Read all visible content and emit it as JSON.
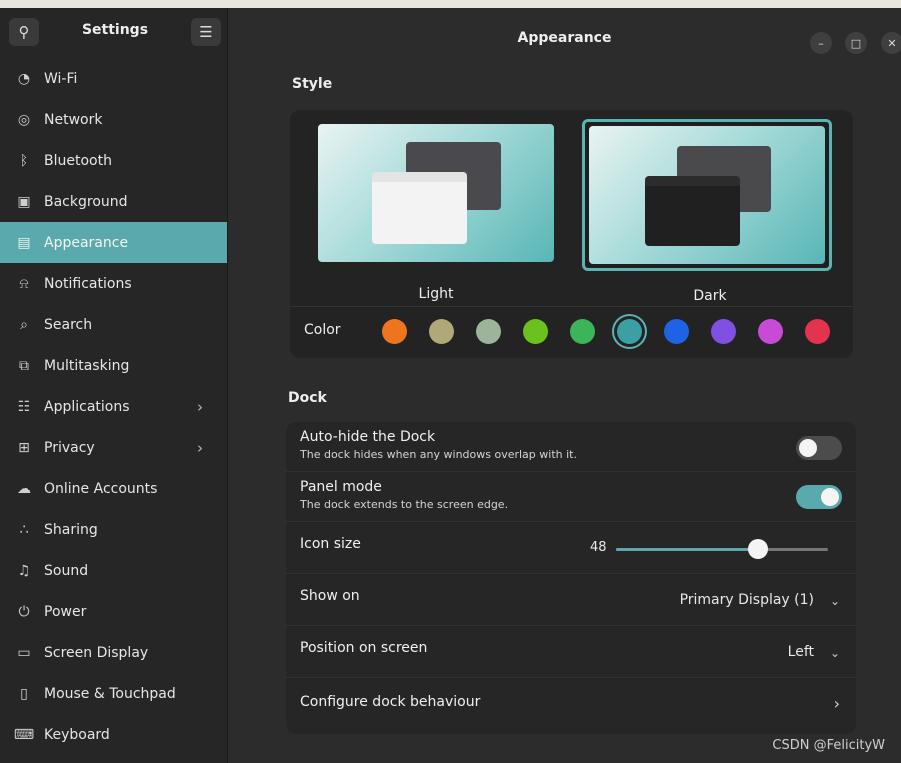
{
  "sidebar": {
    "title": "Settings",
    "search_icon": "search-icon",
    "menu_icon": "hamburger-menu-icon",
    "items": [
      {
        "label": "Wi-Fi",
        "icon": "wifi-icon",
        "glyph": "◔"
      },
      {
        "label": "Network",
        "icon": "network-icon",
        "glyph": "◎"
      },
      {
        "label": "Bluetooth",
        "icon": "bluetooth-icon",
        "glyph": "ᛒ"
      },
      {
        "label": "Background",
        "icon": "background-icon",
        "glyph": "▣"
      },
      {
        "label": "Appearance",
        "icon": "appearance-icon",
        "glyph": "▤",
        "active": true
      },
      {
        "label": "Notifications",
        "icon": "bell-icon",
        "glyph": "⍾"
      },
      {
        "label": "Search",
        "icon": "search-icon",
        "glyph": "⌕"
      },
      {
        "label": "Multitasking",
        "icon": "multitasking-icon",
        "glyph": "⧉"
      },
      {
        "label": "Applications",
        "icon": "grid-icon",
        "glyph": "☷",
        "chevron": "›"
      },
      {
        "label": "Privacy",
        "icon": "lock-icon",
        "glyph": "⊞",
        "chevron": "›"
      },
      {
        "label": "Online Accounts",
        "icon": "cloud-icon",
        "glyph": "☁"
      },
      {
        "label": "Sharing",
        "icon": "share-icon",
        "glyph": "∴"
      },
      {
        "label": "Sound",
        "icon": "music-note-icon",
        "glyph": "♫"
      },
      {
        "label": "Power",
        "icon": "power-icon",
        "glyph": "⏻"
      },
      {
        "label": "Screen Display",
        "icon": "monitor-icon",
        "glyph": "▭"
      },
      {
        "label": "Mouse & Touchpad",
        "icon": "mouse-icon",
        "glyph": "▯"
      },
      {
        "label": "Keyboard",
        "icon": "keyboard-icon",
        "glyph": "⌨"
      }
    ]
  },
  "header": {
    "title": "Appearance",
    "minimize": "–",
    "maximize": "□",
    "close": "✕"
  },
  "style": {
    "section_title": "Style",
    "light_label": "Light",
    "dark_label": "Dark",
    "selected": "Dark",
    "color_label": "Color",
    "swatches": [
      "#ee7420",
      "#b0a878",
      "#9db39a",
      "#6bc21f",
      "#3cb55a",
      "#3c9fa3",
      "#1e62e6",
      "#8050e2",
      "#c84bd6",
      "#e3334f"
    ],
    "selected_swatch": 5
  },
  "dock": {
    "section_title": "Dock",
    "autohide": {
      "title": "Auto-hide the Dock",
      "subtitle": "The dock hides when any windows overlap with it.",
      "enabled": false
    },
    "panel_mode": {
      "title": "Panel mode",
      "subtitle": "The dock extends to the screen edge.",
      "enabled": true
    },
    "icon_size": {
      "title": "Icon size",
      "value": "48",
      "fraction": 0.67
    },
    "show_on": {
      "title": "Show on",
      "value": "Primary Display (1)"
    },
    "position": {
      "title": "Position on screen",
      "value": "Left"
    },
    "configure": {
      "title": "Configure dock behaviour"
    }
  },
  "watermark": "CSDN @FelicityW"
}
